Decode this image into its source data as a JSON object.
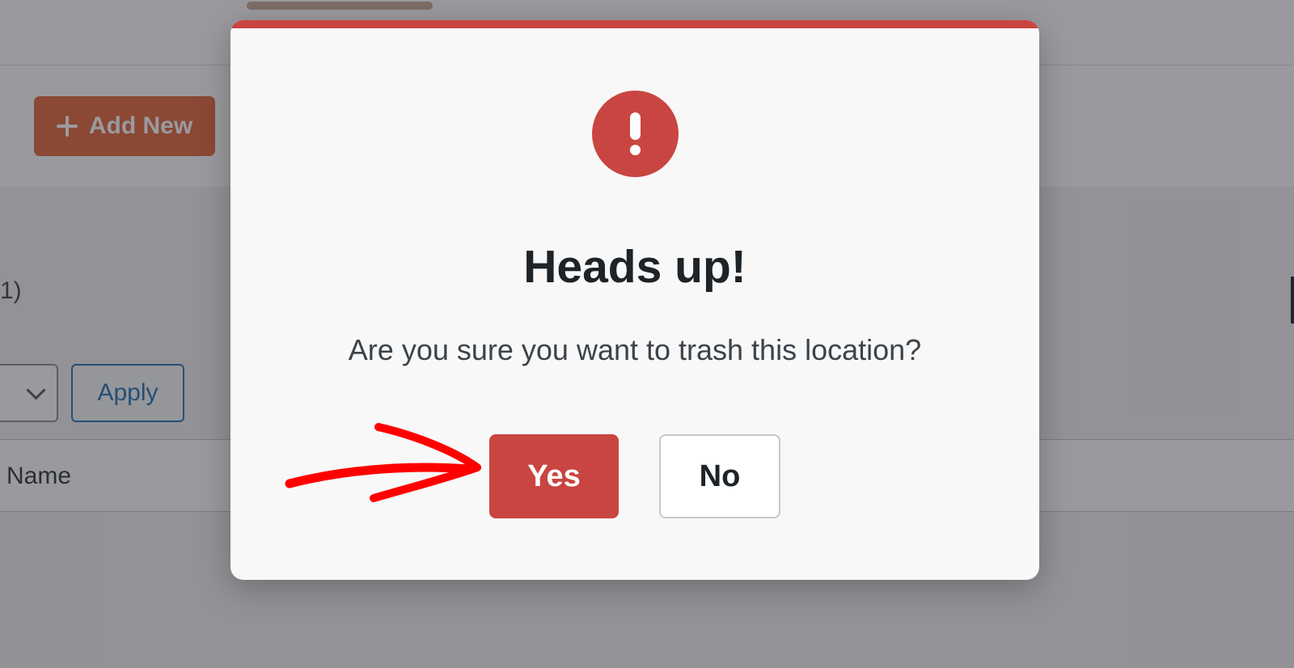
{
  "background": {
    "toolbar": {
      "add_new_label": "Add New",
      "add_new_icon": "plus-icon"
    },
    "list": {
      "count_fragment": "1)",
      "apply_label": "Apply",
      "name_column_header": "Name"
    }
  },
  "dialog": {
    "icon": "exclamation-alert-icon",
    "title": "Heads up!",
    "message": "Are you sure you want to trash this location?",
    "yes_label": "Yes",
    "no_label": "No"
  },
  "annotation": {
    "type": "hand-drawn-arrow",
    "points_to": "yes-button"
  },
  "colors": {
    "accent_red": "#c94541",
    "brand_orange": "#e0643a",
    "link_blue": "#2271b1",
    "annotation_red": "#ff0000"
  }
}
